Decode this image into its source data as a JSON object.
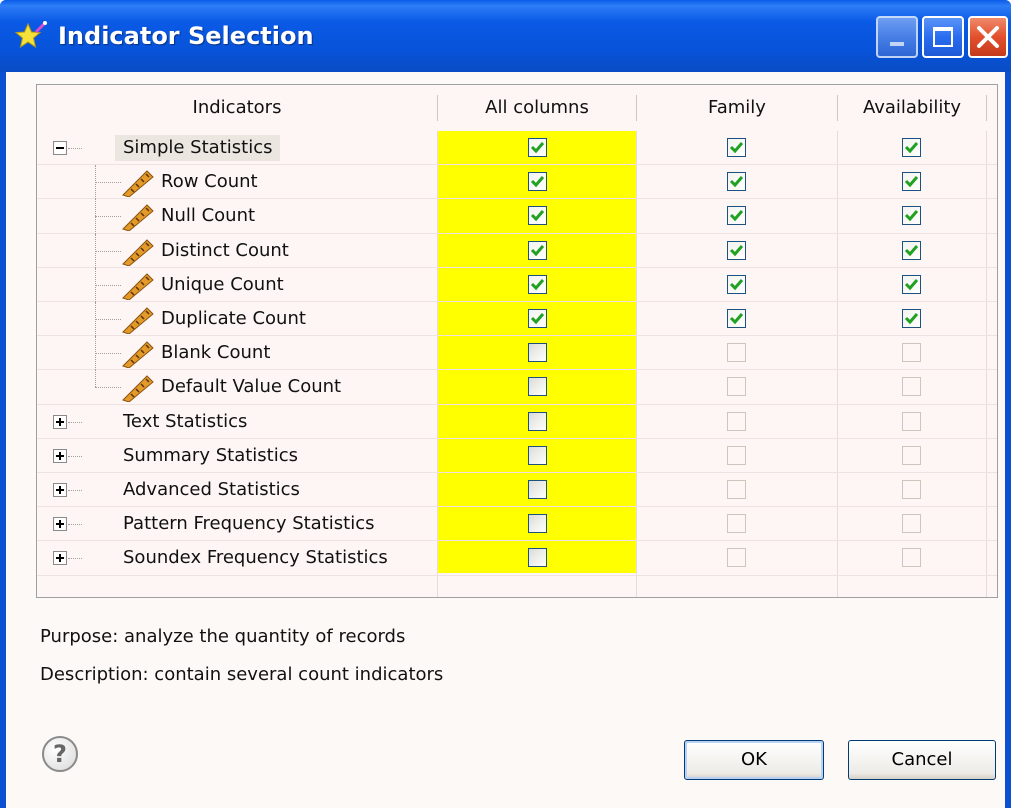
{
  "window": {
    "title": "Indicator Selection",
    "icon": "star-wand-icon"
  },
  "grid": {
    "columns": [
      "Indicators",
      "All columns",
      "Family",
      "Availability"
    ],
    "rows": [
      {
        "label": "Simple Statistics",
        "level": 0,
        "expander": "minus",
        "selected": true,
        "icon": null,
        "all_columns": "checked",
        "family": "checked",
        "availability": "checked"
      },
      {
        "label": "Row Count",
        "level": 1,
        "expander": null,
        "selected": false,
        "icon": "ruler-icon",
        "all_columns": "checked",
        "family": "checked",
        "availability": "checked"
      },
      {
        "label": "Null Count",
        "level": 1,
        "expander": null,
        "selected": false,
        "icon": "ruler-icon",
        "all_columns": "checked",
        "family": "checked",
        "availability": "checked"
      },
      {
        "label": "Distinct Count",
        "level": 1,
        "expander": null,
        "selected": false,
        "icon": "ruler-icon",
        "all_columns": "checked",
        "family": "checked",
        "availability": "checked"
      },
      {
        "label": "Unique Count",
        "level": 1,
        "expander": null,
        "selected": false,
        "icon": "ruler-icon",
        "all_columns": "checked",
        "family": "checked",
        "availability": "checked"
      },
      {
        "label": "Duplicate Count",
        "level": 1,
        "expander": null,
        "selected": false,
        "icon": "ruler-icon",
        "all_columns": "checked",
        "family": "checked",
        "availability": "checked"
      },
      {
        "label": "Blank Count",
        "level": 1,
        "expander": null,
        "selected": false,
        "icon": "ruler-icon",
        "all_columns": "unchecked",
        "family": "disabled",
        "availability": "disabled"
      },
      {
        "label": "Default Value Count",
        "level": 1,
        "expander": null,
        "selected": false,
        "icon": "ruler-icon",
        "all_columns": "unchecked",
        "family": "disabled",
        "availability": "disabled"
      },
      {
        "label": "Text Statistics",
        "level": 0,
        "expander": "plus",
        "selected": false,
        "icon": null,
        "all_columns": "unchecked",
        "family": "disabled",
        "availability": "disabled"
      },
      {
        "label": "Summary Statistics",
        "level": 0,
        "expander": "plus",
        "selected": false,
        "icon": null,
        "all_columns": "unchecked",
        "family": "disabled",
        "availability": "disabled"
      },
      {
        "label": "Advanced Statistics",
        "level": 0,
        "expander": "plus",
        "selected": false,
        "icon": null,
        "all_columns": "unchecked",
        "family": "disabled",
        "availability": "disabled"
      },
      {
        "label": "Pattern Frequency Statistics",
        "level": 0,
        "expander": "plus",
        "selected": false,
        "icon": null,
        "all_columns": "unchecked",
        "family": "disabled",
        "availability": "disabled"
      },
      {
        "label": "Soundex Frequency Statistics",
        "level": 0,
        "expander": "plus",
        "selected": false,
        "icon": null,
        "all_columns": "unchecked",
        "family": "disabled",
        "availability": "disabled"
      }
    ]
  },
  "info": {
    "purpose": "Purpose: analyze the quantity of records",
    "description": "Description: contain several count indicators"
  },
  "buttons": {
    "help": "?",
    "ok": "OK",
    "cancel": "Cancel"
  },
  "colors": {
    "title_bar": "#0753d9",
    "highlight_column": "#ffff00",
    "check_mark": "#21a121"
  }
}
